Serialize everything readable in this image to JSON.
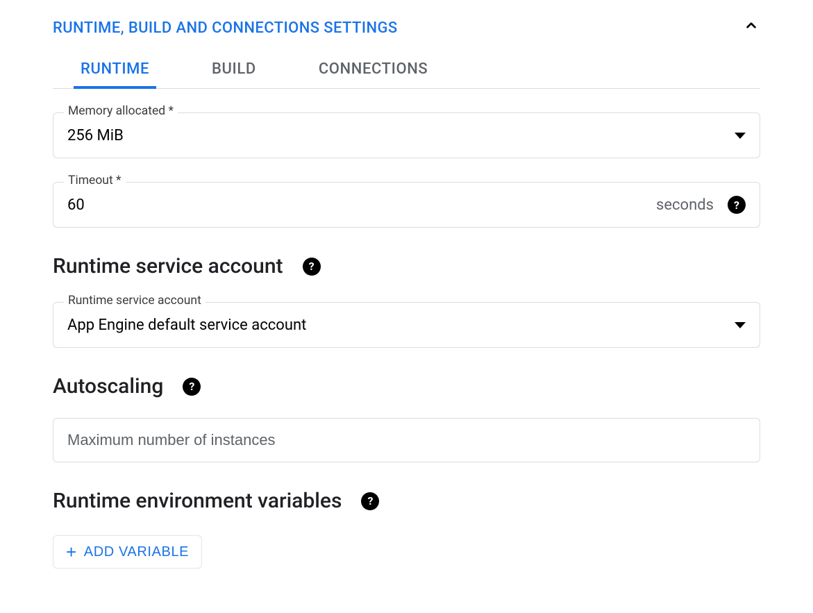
{
  "header": {
    "title": "RUNTIME, BUILD AND CONNECTIONS SETTINGS"
  },
  "tabs": {
    "runtime": "RUNTIME",
    "build": "BUILD",
    "connections": "CONNECTIONS"
  },
  "memory": {
    "label": "Memory allocated *",
    "value": "256 MiB"
  },
  "timeout": {
    "label": "Timeout *",
    "value": "60",
    "suffix": "seconds"
  },
  "service_account": {
    "heading": "Runtime service account",
    "label": "Runtime service account",
    "value": "App Engine default service account"
  },
  "autoscaling": {
    "heading": "Autoscaling",
    "placeholder": "Maximum number of instances"
  },
  "env": {
    "heading": "Runtime environment variables",
    "add_label": "ADD VARIABLE"
  }
}
